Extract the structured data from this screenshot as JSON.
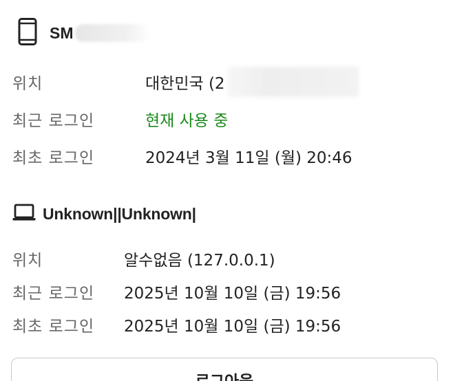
{
  "sessions": [
    {
      "device_icon": "smartphone-icon",
      "device_name": "SM",
      "location_label": "위치",
      "location_value": "대한민국 (2",
      "last_login_label": "최근 로그인",
      "last_login_value": "현재 사용 중",
      "first_login_label": "최초 로그인",
      "first_login_value": "2024년 3월 11일 (월) 20:46"
    },
    {
      "device_icon": "laptop-icon",
      "device_name": "Unknown||Unknown|",
      "location_label": "위치",
      "location_value": "알수없음 (127.0.0.1)",
      "last_login_label": "최근 로그인",
      "last_login_value": "2025년 10월 10일 (금) 19:56",
      "first_login_label": "최초 로그인",
      "first_login_value": "2025년 10월 10일 (금) 19:56"
    }
  ],
  "logout_button_label": "로그아웃",
  "colors": {
    "active_status": "#1a8a1a",
    "label": "#666666",
    "text": "#222222"
  }
}
